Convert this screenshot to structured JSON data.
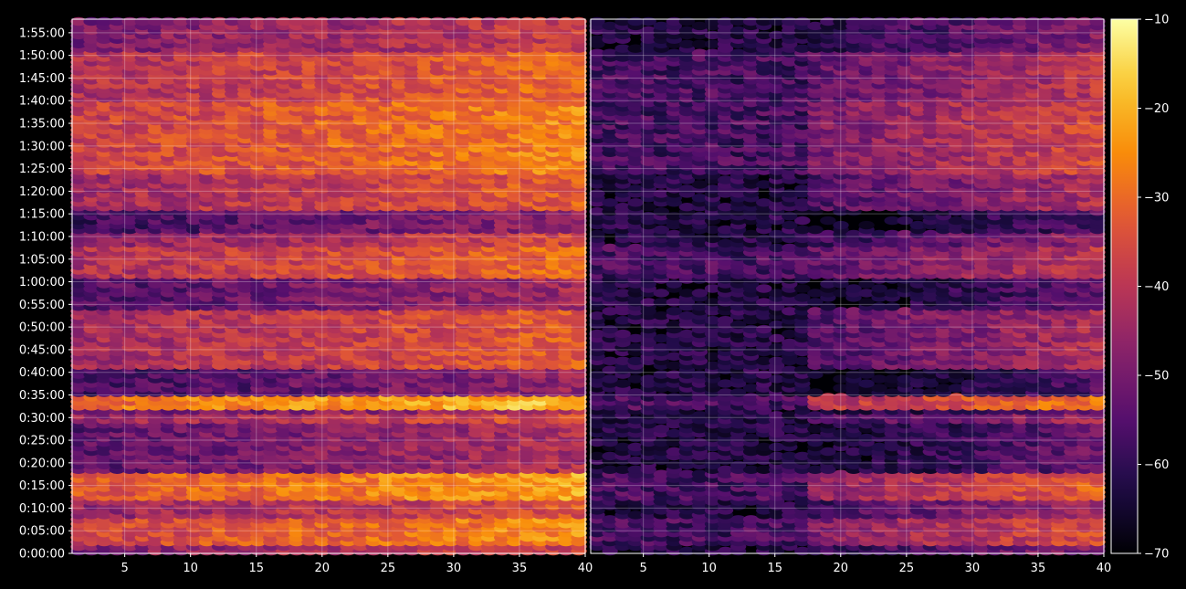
{
  "chart_data": {
    "type": "heatmap",
    "panels": [
      {
        "name": "",
        "x_range": [
          1,
          40
        ],
        "x_ticks": [
          5,
          10,
          15,
          20,
          25,
          30,
          35,
          40
        ],
        "x_tick_labels": [
          "5",
          "10",
          "15",
          "20",
          "25",
          "30",
          "35",
          "40"
        ],
        "y_range_minutes": [
          0,
          118
        ],
        "y_tick_labels": [
          "0:00:00",
          "0:05:00",
          "0:10:00",
          "0:15:00",
          "0:20:00",
          "0:25:00",
          "0:30:00",
          "0:35:00",
          "0:40:00",
          "0:45:00",
          "0:50:00",
          "0:55:00",
          "1:00:00",
          "1:05:00",
          "1:10:00",
          "1:15:00",
          "1:20:00",
          "1:25:00",
          "1:30:00",
          "1:35:00",
          "1:40:00",
          "1:45:00",
          "1:50:00",
          "1:55:00"
        ],
        "baseline_db": -50,
        "column_gain_db": [
          -4,
          8
        ],
        "dark_region": null
      },
      {
        "name": "",
        "x_range": [
          1,
          40
        ],
        "x_ticks": [
          5,
          10,
          15,
          20,
          25,
          30,
          35,
          40
        ],
        "x_tick_labels": [
          "5",
          "10",
          "15",
          "20",
          "25",
          "30",
          "35",
          "40"
        ],
        "y_range_minutes": [
          0,
          118
        ],
        "baseline_db": -62,
        "column_gain_db": [
          -14,
          10
        ],
        "dark_region": [
          1,
          17
        ]
      }
    ],
    "row_band_profile_db": [
      {
        "minutes": [
          0,
          1
        ],
        "level": -45
      },
      {
        "minutes": [
          2,
          7
        ],
        "level": -33
      },
      {
        "minutes": [
          8,
          11
        ],
        "level": -42
      },
      {
        "minutes": [
          12,
          17
        ],
        "level": -30
      },
      {
        "minutes": [
          18,
          30
        ],
        "level": -50
      },
      {
        "minutes": [
          29,
          30
        ],
        "level": -42
      },
      {
        "minutes": [
          32,
          34
        ],
        "level": -26
      },
      {
        "minutes": [
          35,
          40
        ],
        "level": -54
      },
      {
        "minutes": [
          41,
          53
        ],
        "level": -40
      },
      {
        "minutes": [
          54,
          60
        ],
        "level": -52
      },
      {
        "minutes": [
          61,
          67
        ],
        "level": -38
      },
      {
        "minutes": [
          68,
          70
        ],
        "level": -44
      },
      {
        "minutes": [
          71,
          75
        ],
        "level": -54
      },
      {
        "minutes": [
          76,
          83
        ],
        "level": -40
      },
      {
        "minutes": [
          84,
          92
        ],
        "level": -34
      },
      {
        "minutes": [
          93,
          99
        ],
        "level": -34
      },
      {
        "minutes": [
          100,
          110
        ],
        "level": -38
      },
      {
        "minutes": [
          111,
          118
        ],
        "level": -46
      }
    ],
    "colorbar": {
      "colormap": "inferno",
      "range": [
        -70,
        -10
      ],
      "ticks": [
        -70,
        -60,
        -50,
        -40,
        -30,
        -20,
        -10
      ],
      "tick_labels": [
        "−70",
        "−60",
        "−50",
        "−40",
        "−30",
        "−20",
        "−10"
      ]
    },
    "grid": true,
    "background": "#000000"
  }
}
